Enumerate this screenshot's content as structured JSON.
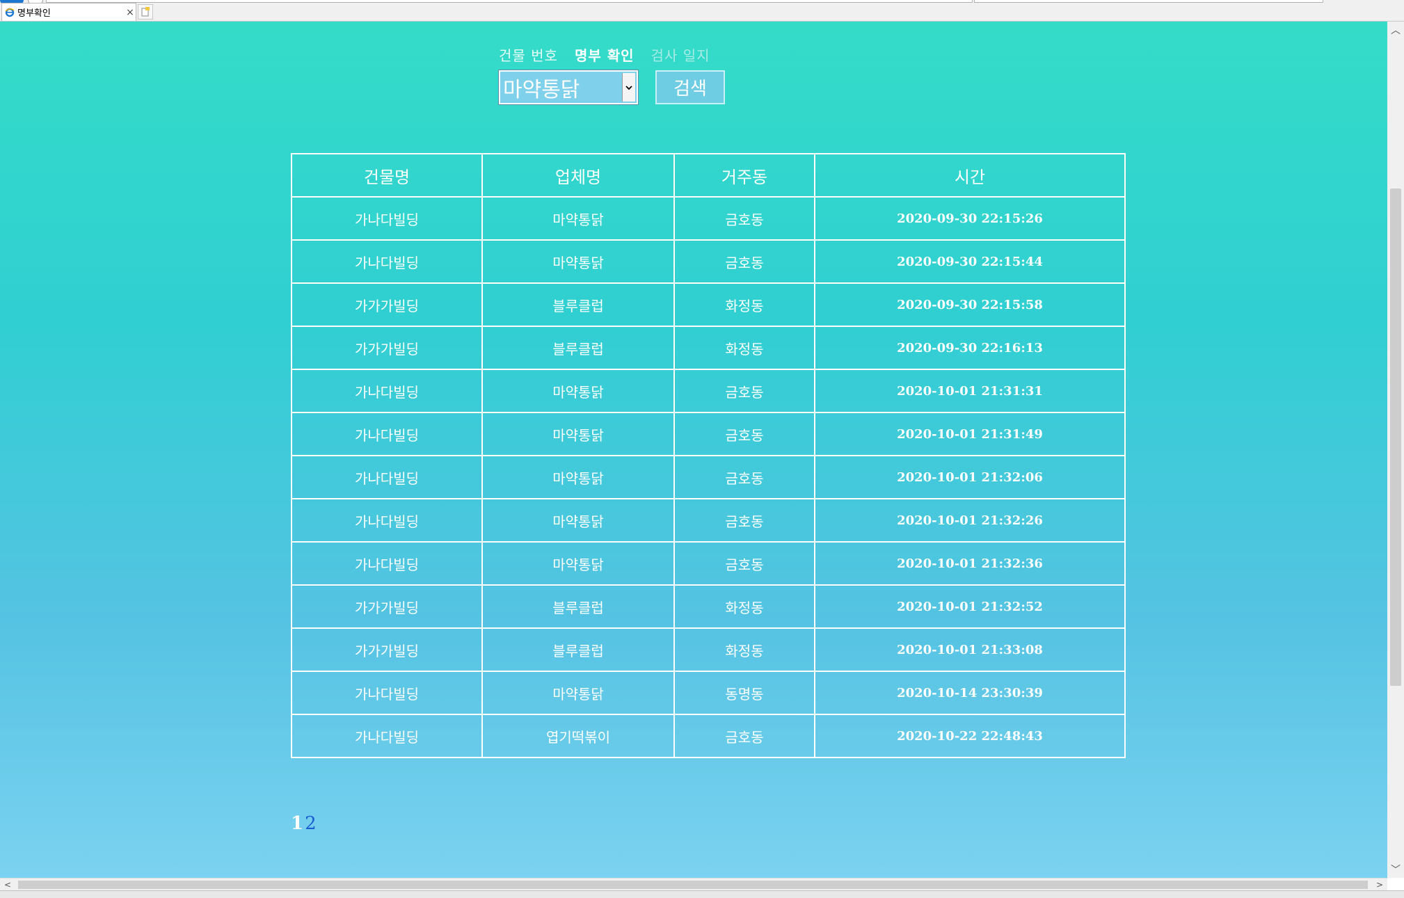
{
  "browser": {
    "tab_title": "명부확인",
    "close_glyph": "×"
  },
  "nav": {
    "building_number": "건물 번호",
    "register_check": "명부 확인",
    "inspection_log": "검사 일지"
  },
  "search": {
    "selected_store": "마약통닭",
    "button_label": "검색"
  },
  "table": {
    "headers": [
      "건물명",
      "업체명",
      "거주동",
      "시간"
    ],
    "rows": [
      [
        "가나다빌딩",
        "마약통닭",
        "금호동",
        "2020-09-30 22:15:26"
      ],
      [
        "가나다빌딩",
        "마약통닭",
        "금호동",
        "2020-09-30 22:15:44"
      ],
      [
        "가가가빌딩",
        "블루클럽",
        "화정동",
        "2020-09-30 22:15:58"
      ],
      [
        "가가가빌딩",
        "블루클럽",
        "화정동",
        "2020-09-30 22:16:13"
      ],
      [
        "가나다빌딩",
        "마약통닭",
        "금호동",
        "2020-10-01 21:31:31"
      ],
      [
        "가나다빌딩",
        "마약통닭",
        "금호동",
        "2020-10-01 21:31:49"
      ],
      [
        "가나다빌딩",
        "마약통닭",
        "금호동",
        "2020-10-01 21:32:06"
      ],
      [
        "가나다빌딩",
        "마약통닭",
        "금호동",
        "2020-10-01 21:32:26"
      ],
      [
        "가나다빌딩",
        "마약통닭",
        "금호동",
        "2020-10-01 21:32:36"
      ],
      [
        "가가가빌딩",
        "블루클럽",
        "화정동",
        "2020-10-01 21:32:52"
      ],
      [
        "가가가빌딩",
        "블루클럽",
        "화정동",
        "2020-10-01 21:33:08"
      ],
      [
        "가나다빌딩",
        "마약통닭",
        "동명동",
        "2020-10-14 23:30:39"
      ],
      [
        "가나다빌딩",
        "엽기떡볶이",
        "금호동",
        "2020-10-22 22:48:43"
      ]
    ]
  },
  "pagination": {
    "current": "1",
    "next": "2"
  },
  "colors": {
    "gradient_top": "#34dcc8",
    "gradient_bottom": "#7bd2f0",
    "border": "#ffffff",
    "page_link": "#1a5fd0"
  }
}
